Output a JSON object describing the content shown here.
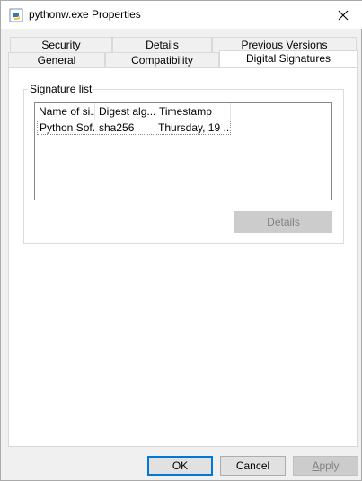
{
  "window": {
    "title": "pythonw.exe Properties",
    "icon": "python-file-icon"
  },
  "tabs": {
    "row_back": [
      "Security",
      "Details",
      "Previous Versions"
    ],
    "row_front": [
      "General",
      "Compatibility",
      "Digital Signatures"
    ],
    "active": "Digital Signatures"
  },
  "signature_list": {
    "group_label": "Signature list",
    "columns": [
      "Name of si...",
      "Digest alg...",
      "Timestamp"
    ],
    "rows": [
      [
        "Python Sof...",
        "sha256",
        "Thursday, 19 ..."
      ]
    ],
    "details_button": {
      "prefix": "",
      "underlined": "D",
      "suffix": "etails"
    }
  },
  "footer": {
    "ok": "OK",
    "cancel": "Cancel",
    "apply": {
      "underlined": "A",
      "suffix": "pply"
    }
  }
}
